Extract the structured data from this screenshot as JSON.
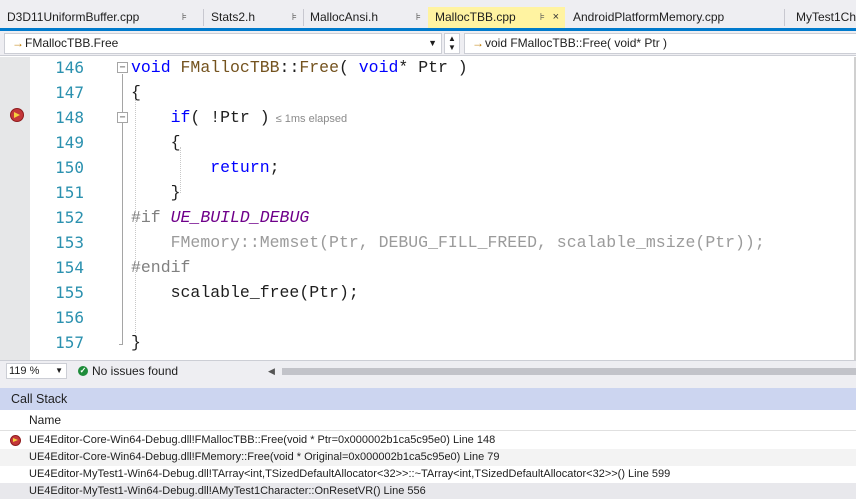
{
  "tabs": [
    {
      "label": "D3D11UniformBuffer.cpp",
      "pin": "⊧"
    },
    {
      "label": "Stats2.h",
      "pin": "⊧"
    },
    {
      "label": "MallocAnsi.h",
      "pin": "⊧"
    },
    {
      "label": "MallocTBB.cpp",
      "pin": "⊧",
      "close": "×",
      "active": true
    },
    {
      "label": "AndroidPlatformMemory.cpp",
      "pin": ""
    },
    {
      "label": "MyTest1Ch",
      "pin": ""
    }
  ],
  "navbar": {
    "scope": "FMallocTBB.Free",
    "member": "void FMallocTBB::Free( void* Ptr )",
    "arrow_glyph": "→"
  },
  "editor": {
    "accent": "#007acc",
    "line_numbers": [
      "146",
      "147",
      "148",
      "149",
      "150",
      "151",
      "152",
      "153",
      "154",
      "155",
      "156",
      "157"
    ],
    "current_line": "148",
    "perf_tip": "≤ 1ms elapsed",
    "lines": {
      "l146": {
        "kw1": "void",
        "fn": "FMallocTBB",
        "sep": "::",
        "fn2": "Free",
        "open": "( ",
        "kw2": "void",
        "rest": "* Ptr )"
      },
      "l147": {
        "text": "{"
      },
      "l148": {
        "kw": "if",
        "rest": "( !Ptr )"
      },
      "l149": {
        "text": "{"
      },
      "l150": {
        "kw": "return",
        "rest": ";"
      },
      "l151": {
        "text": "}"
      },
      "l152": {
        "pp": "#if",
        "macro": "UE_BUILD_DEBUG"
      },
      "l153": {
        "ns": "FMemory",
        "sep": "::",
        "fn": "Memset",
        "args": "(Ptr, DEBUG_FILL_FREED, scalable_msize(Ptr));"
      },
      "l154": {
        "pp": "#endif"
      },
      "l155": {
        "fn": "scalable_free",
        "rest": "(Ptr);"
      },
      "l156": {
        "text": ""
      },
      "l157": {
        "text": "}"
      }
    }
  },
  "status": {
    "zoom": "119 %",
    "issues": "No issues found"
  },
  "callstack": {
    "title": "Call Stack",
    "column": "Name",
    "rows": [
      "UE4Editor-Core-Win64-Debug.dll!FMallocTBB::Free(void * Ptr=0x000002b1ca5c95e0) Line 148",
      "UE4Editor-Core-Win64-Debug.dll!FMemory::Free(void * Original=0x000002b1ca5c95e0) Line 79",
      "UE4Editor-MyTest1-Win64-Debug.dll!TArray<int,TSizedDefaultAllocator<32>>::~TArray<int,TSizedDefaultAllocator<32>>() Line 599",
      "UE4Editor-MyTest1-Win64-Debug.dll!AMyTest1Character::OnResetVR() Line 556"
    ]
  }
}
